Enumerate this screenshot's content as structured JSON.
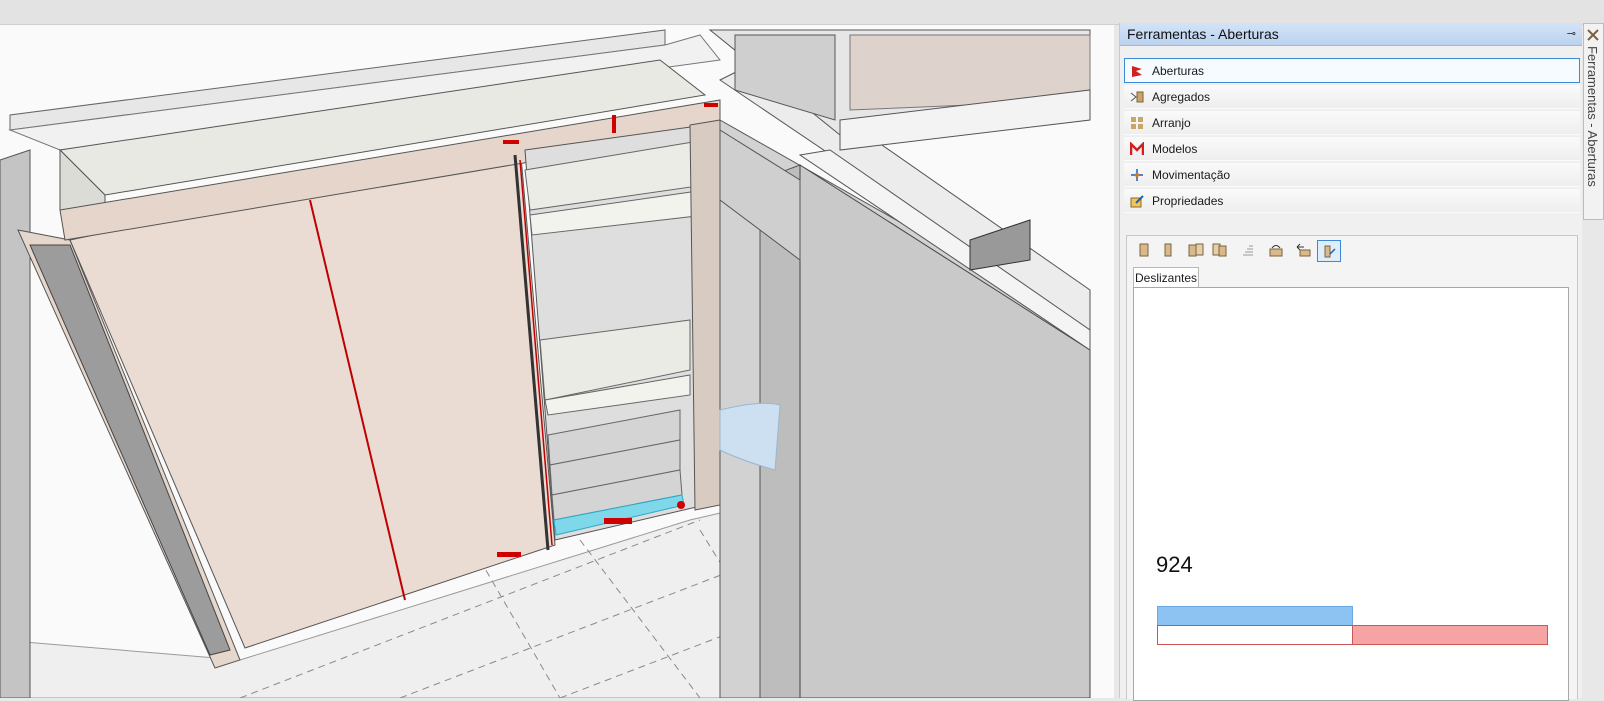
{
  "panel": {
    "title": "Ferramentas - Aberturas",
    "pin_glyph": "⊸",
    "menu": [
      {
        "label": "Aberturas",
        "icon": "aberturas-icon",
        "selected": true
      },
      {
        "label": "Agregados",
        "icon": "agregados-icon",
        "selected": false
      },
      {
        "label": "Arranjo",
        "icon": "arranjo-icon",
        "selected": false
      },
      {
        "label": "Modelos",
        "icon": "modelos-icon",
        "selected": false
      },
      {
        "label": "Movimentação",
        "icon": "movimentacao-icon",
        "selected": false
      },
      {
        "label": "Propriedades",
        "icon": "propriedades-icon",
        "selected": false
      }
    ],
    "toolbar": [
      {
        "icon": "door-single-icon",
        "active": false
      },
      {
        "icon": "door-narrow-icon",
        "active": false
      },
      {
        "icon": "doors-group-icon",
        "active": false
      },
      {
        "icon": "doors-copy-icon",
        "active": false
      },
      {
        "icon": "align-icon",
        "active": false
      },
      {
        "icon": "rotate-door-icon",
        "active": false
      },
      {
        "icon": "move-left-icon",
        "active": false
      },
      {
        "icon": "sliding-door-icon",
        "active": true
      }
    ],
    "tab": "Deslizantes",
    "dimension": "924"
  },
  "sidetab": {
    "label": "Ferramentas - Aberturas",
    "icon": "tools-icon"
  },
  "colors": {
    "accent_blue": "#8cc3f3",
    "accent_red": "#f5a3a3",
    "selection_border": "#3a8ad8",
    "door_texture": "#eadbd3"
  }
}
